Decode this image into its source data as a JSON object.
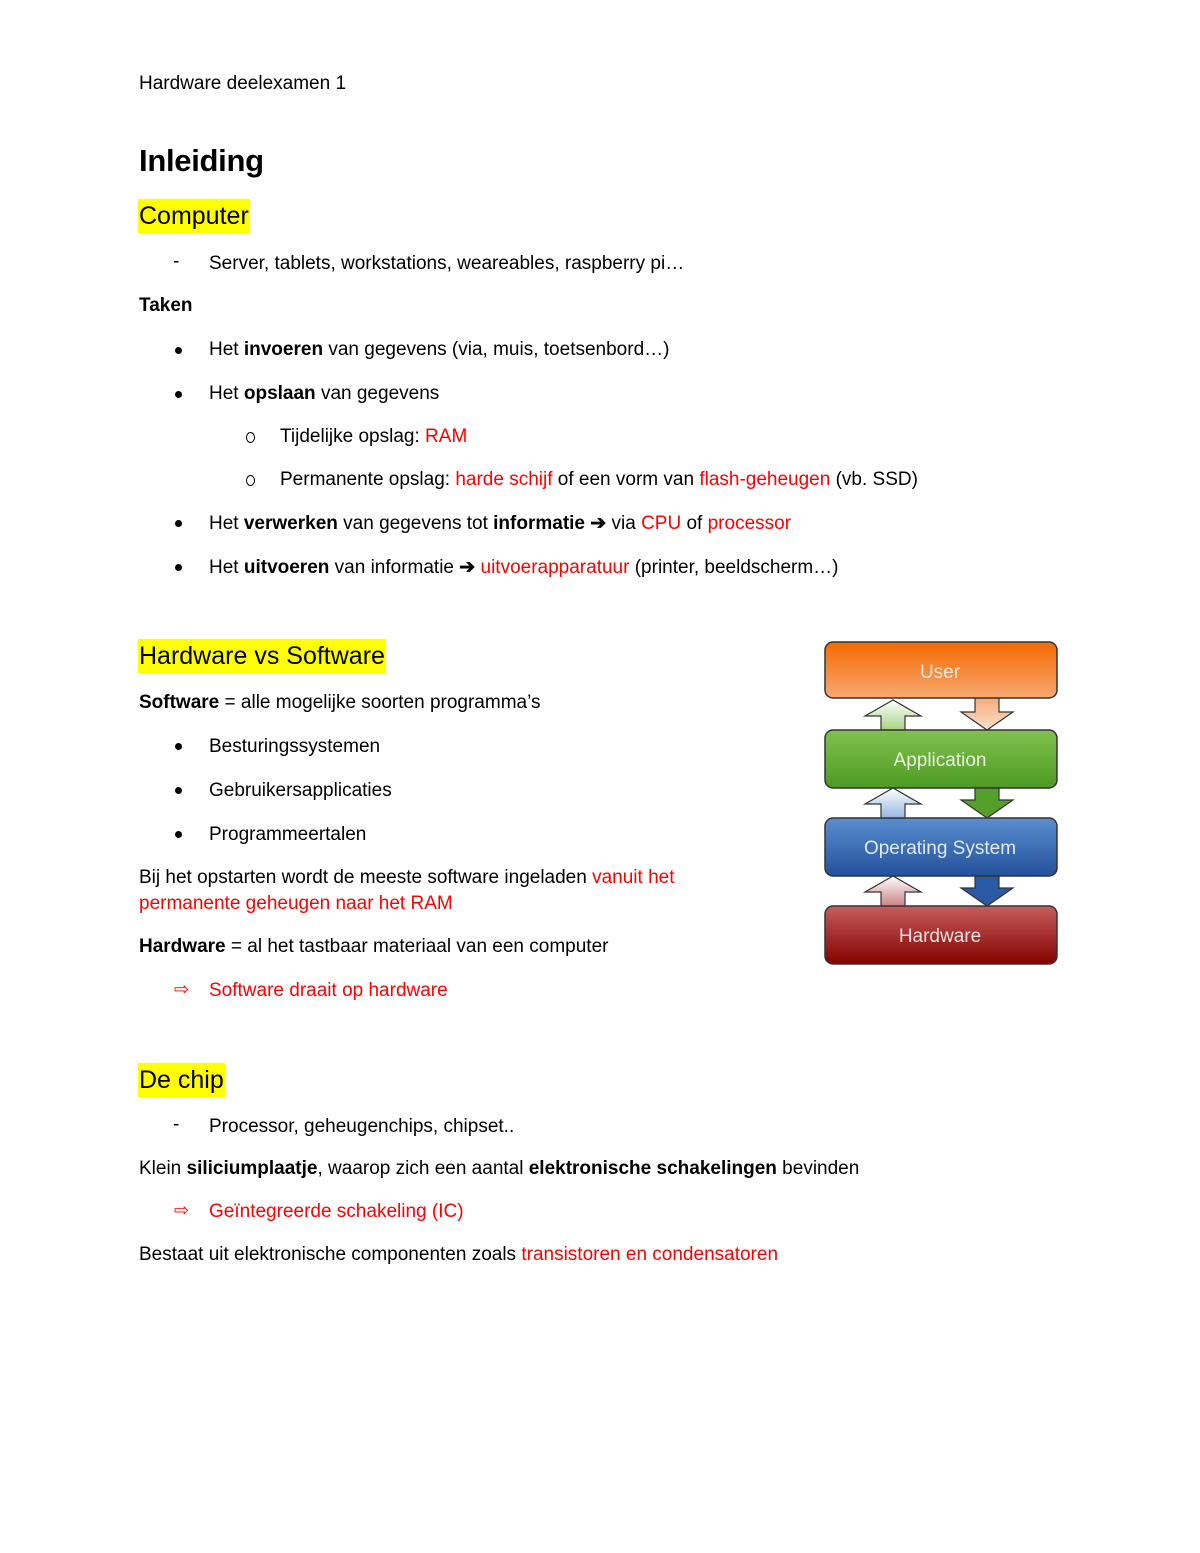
{
  "header": {
    "text": "Hardware deelexamen 1"
  },
  "title": "Inleiding",
  "sections": {
    "computer": {
      "heading": "Computer",
      "dash_item": "Server, tablets, workstations, weareables, raspberry pi…",
      "taken_label": "Taken",
      "tasks": [
        {
          "pre": "Het ",
          "bold": "invoeren",
          "post": " van gegevens (via, muis, toetsenbord…)"
        },
        {
          "pre": "Het ",
          "bold": "opslaan",
          "post": " van gegevens",
          "sub": [
            {
              "text": "Tijdelijke opslag: ",
              "red": "RAM"
            },
            {
              "text": "Permanente opslag: ",
              "red1": "harde schijf",
              "mid": " of een vorm van ",
              "red2": "flash-geheugen",
              "post": " (vb. SSD)"
            }
          ]
        },
        {
          "pre": "Het ",
          "bold": "verwerken",
          "mid": " van gegevens tot ",
          "bold2": "informatie",
          "arrow": " ➔ ",
          "via": "via ",
          "red1": "CPU",
          "of": " of ",
          "red2": "processor"
        },
        {
          "pre": "Het ",
          "bold": "uitvoeren",
          "mid": " van informatie ",
          "arrow": "➔ ",
          "red": "uitvoerapparatuur",
          "post": " (printer, beeldscherm…)"
        }
      ]
    },
    "hw_vs_sw": {
      "heading": "Hardware vs Software",
      "software_def": {
        "bold": "Software",
        "text": " = alle mogelijke soorten programma’s"
      },
      "software_items": [
        "Besturingssystemen",
        "Gebruikersapplicaties",
        "Programmeertalen"
      ],
      "startup": {
        "text": "Bij het opstarten wordt de meeste software ingeladen ",
        "red_line1": "vanuit het",
        "red_line2": "permanente geheugen naar het RAM"
      },
      "hardware_def": {
        "bold": "Hardware",
        "text": " = al het tastbaar materiaal van een computer"
      },
      "conclusion": "Software draait op hardware"
    },
    "chip": {
      "heading": "De chip",
      "dash_item": "Processor, geheugenchips, chipset..",
      "desc": {
        "pre": "Klein ",
        "bold1": "siliciumplaatje",
        "mid": ", waarop zich een aantal ",
        "bold2": "elektronische schakelingen",
        "post": " bevinden"
      },
      "conclusion": "Geïntegreerde schakeling (IC)",
      "components": {
        "text": "Bestaat uit elektronische componenten zoals ",
        "red": "transistoren en condensatoren"
      }
    }
  },
  "diagram": {
    "layers": [
      {
        "label": "User",
        "color": "#f26b0f"
      },
      {
        "label": "Application",
        "color": "#5da52a"
      },
      {
        "label": "Operating System",
        "color": "#2f63ad"
      },
      {
        "label": "Hardware",
        "color": "#9b1010"
      }
    ]
  }
}
